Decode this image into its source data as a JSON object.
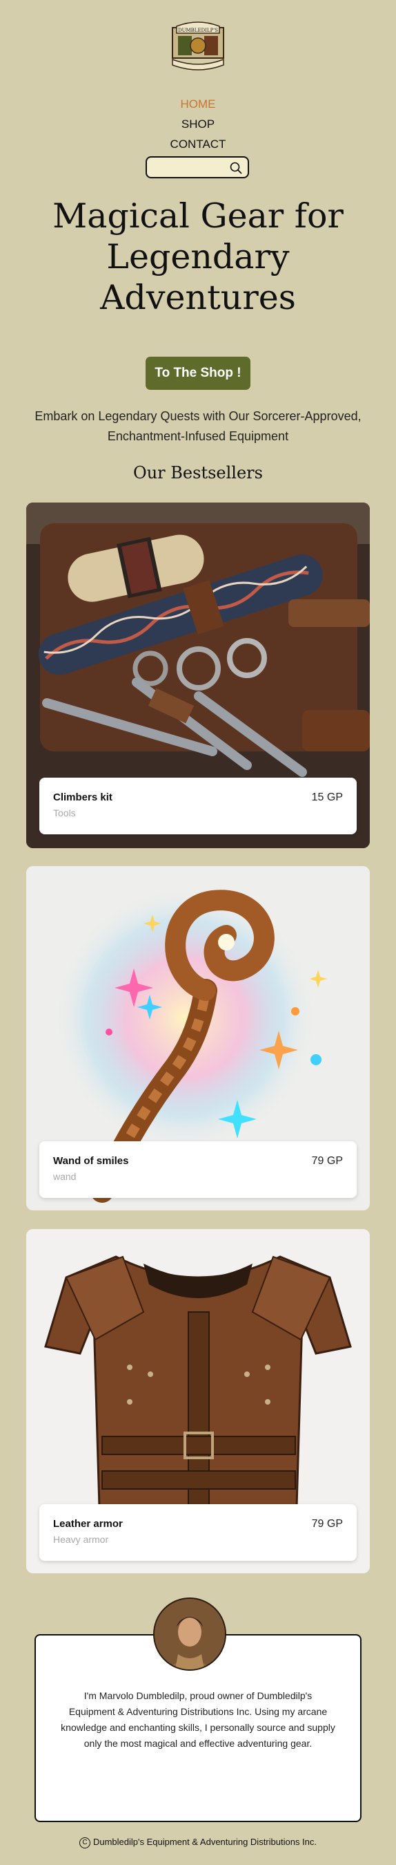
{
  "logo": {
    "text_top": "DUMBLEDILP'S",
    "text_bottom": "& Adventuring Distributions Inc."
  },
  "nav": {
    "home": "HOME",
    "shop": "SHOP",
    "contact": "CONTACT"
  },
  "search": {
    "placeholder": "",
    "icon": "search-icon"
  },
  "hero": {
    "title": "Magical Gear for Legendary Adventures",
    "cta_label": "To The Shop !",
    "tagline": "Embark on Legendary Quests with Our Sorcerer-Approved, Enchantment-Infused Equipment"
  },
  "bestsellers": {
    "title": "Our Bestsellers",
    "products": [
      {
        "name": "Climbers kit",
        "category": "Tools",
        "price": "15 GP"
      },
      {
        "name": "Wand of smiles",
        "category": "wand",
        "price": "79 GP"
      },
      {
        "name": "Leather armor",
        "category": "Heavy armor",
        "price": "79 GP"
      }
    ]
  },
  "about": {
    "text": "I'm Marvolo Dumbledilp, proud owner of Dumbledilp's Equipment & Adventuring Distributions Inc. Using my arcane knowledge and enchanting skills, I personally source and supply only the most magical and effective adventuring gear."
  },
  "footer": {
    "copyright_symbol": "C",
    "text": "Dumbledilp's Equipment & Adventuring Distributions Inc."
  },
  "colors": {
    "background": "#d4ceac",
    "accent": "#5e6b2b",
    "nav_active": "#c8762f"
  }
}
